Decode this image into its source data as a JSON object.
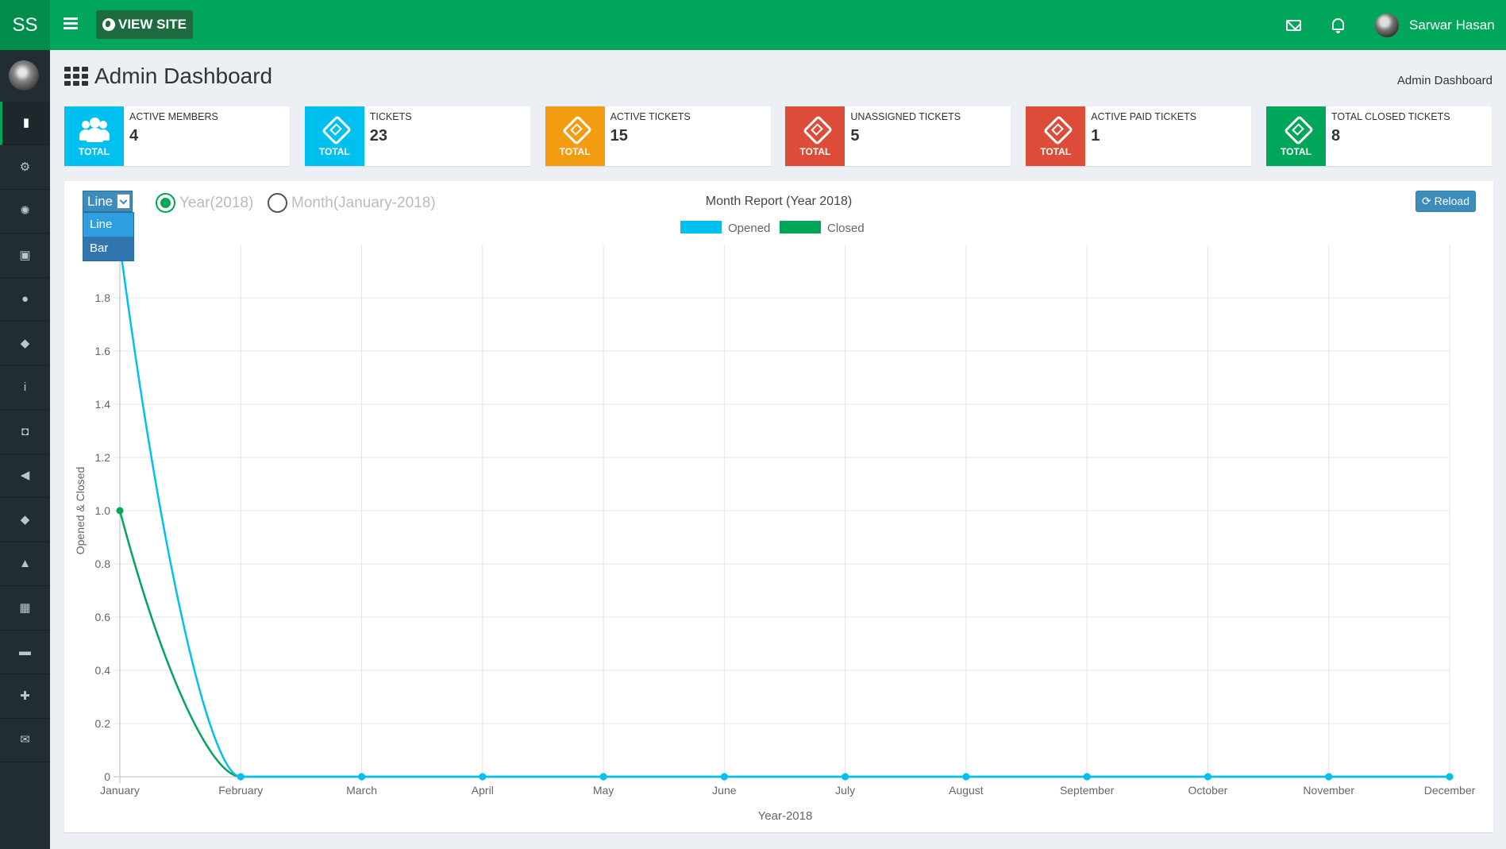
{
  "topbar": {
    "logo": "SS",
    "view_site": "VIEW SITE",
    "user_name": "Sarwar Hasan"
  },
  "sidebar": {
    "items": [
      {
        "icon": "bar-chart-icon",
        "glyph": "▮",
        "active": true
      },
      {
        "icon": "users-cog-icon",
        "glyph": "⚙"
      },
      {
        "icon": "cog-icon",
        "glyph": "✺"
      },
      {
        "icon": "money-icon",
        "glyph": "▣"
      },
      {
        "icon": "user-icon",
        "glyph": "●"
      },
      {
        "icon": "ticket-icon",
        "glyph": "◆"
      },
      {
        "icon": "info-icon",
        "glyph": "i"
      },
      {
        "icon": "camera-icon",
        "glyph": "◘"
      },
      {
        "icon": "bullhorn-icon",
        "glyph": "◀"
      },
      {
        "icon": "ticket-icon-2",
        "glyph": "◆"
      },
      {
        "icon": "graduation-cap-icon",
        "glyph": "▲"
      },
      {
        "icon": "table-icon",
        "glyph": "▦"
      },
      {
        "icon": "comment-icon",
        "glyph": "▬"
      },
      {
        "icon": "puzzle-icon",
        "glyph": "✚"
      },
      {
        "icon": "envelope-icon",
        "glyph": "✉"
      }
    ]
  },
  "header": {
    "title": "Admin Dashboard",
    "breadcrumb": "Admin Dashboard"
  },
  "info_boxes": [
    {
      "label": "ACTIVE MEMBERS",
      "value": "4",
      "badge": "TOTAL",
      "color": "#00c0ef",
      "icon": "users-icon"
    },
    {
      "label": "TICKETS",
      "value": "23",
      "badge": "TOTAL",
      "color": "#00c0ef",
      "icon": "ticket-icon"
    },
    {
      "label": "ACTIVE TICKETS",
      "value": "15",
      "badge": "TOTAL",
      "color": "#f39c12",
      "icon": "ticket-icon"
    },
    {
      "label": "UNASSIGNED TICKETS",
      "value": "5",
      "badge": "TOTAL",
      "color": "#dd4b39",
      "icon": "ticket-icon"
    },
    {
      "label": "ACTIVE PAID TICKETS",
      "value": "1",
      "badge": "TOTAL",
      "color": "#dd4b39",
      "icon": "ticket-icon"
    },
    {
      "label": "TOTAL CLOSED TICKETS",
      "value": "8",
      "badge": "TOTAL",
      "color": "#00a65a",
      "icon": "ticket-icon"
    }
  ],
  "controls": {
    "chart_type_selected": "Line",
    "chart_type_options": [
      "Line",
      "Bar"
    ],
    "radio_year": "Year(2018)",
    "radio_month": "Month(January-2018)",
    "reload": "Reload"
  },
  "chart_data": {
    "type": "line",
    "title": "Month Report (Year 2018)",
    "xlabel": "Year-2018",
    "ylabel": "Opened & Closed",
    "categories": [
      "January",
      "February",
      "March",
      "April",
      "May",
      "June",
      "July",
      "August",
      "September",
      "October",
      "November",
      "December"
    ],
    "series": [
      {
        "name": "Opened",
        "color": "#00c0ef",
        "values": [
          2,
          0,
          0,
          0,
          0,
          0,
          0,
          0,
          0,
          0,
          0,
          0
        ]
      },
      {
        "name": "Closed",
        "color": "#00a65a",
        "values": [
          1,
          0,
          0,
          0,
          0,
          0,
          0,
          0,
          0,
          0,
          0,
          0
        ]
      }
    ],
    "ylim": [
      0,
      2
    ],
    "yticks": [
      "0",
      "0.2",
      "0.4",
      "0.6",
      "0.8",
      "1.0",
      "1.2",
      "1.4",
      "1.6",
      "1.8"
    ],
    "grid": true,
    "legend_position": "top-center"
  }
}
